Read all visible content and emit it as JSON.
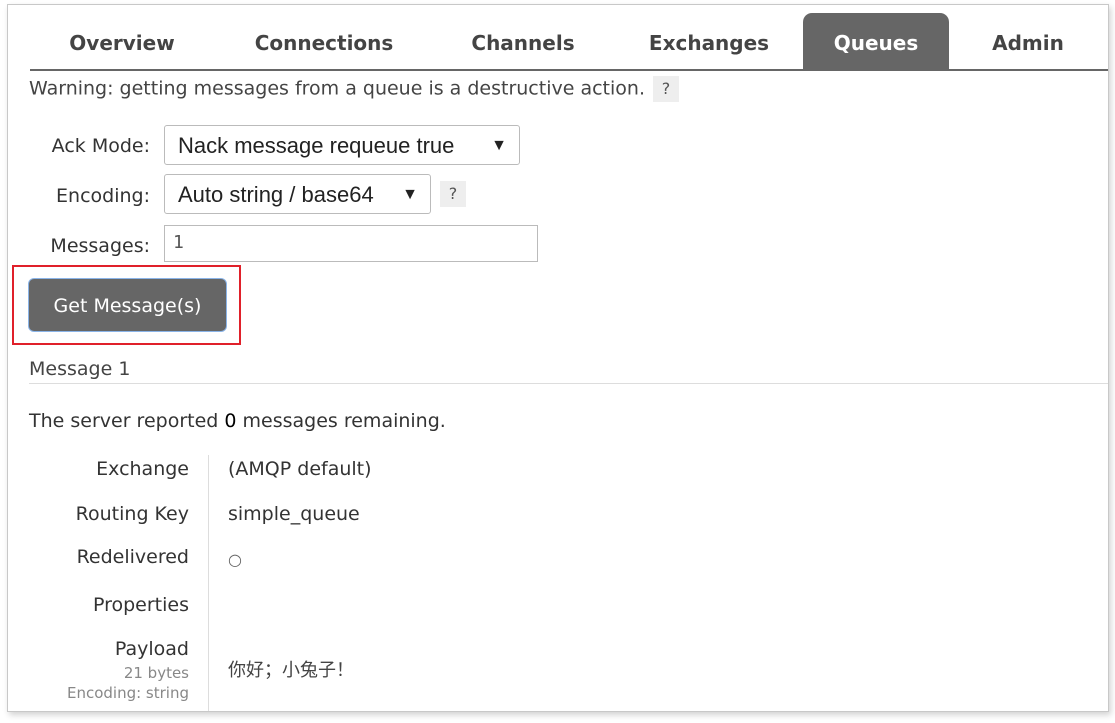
{
  "tabs": [
    {
      "label": "Overview",
      "active": false
    },
    {
      "label": "Connections",
      "active": false
    },
    {
      "label": "Channels",
      "active": false
    },
    {
      "label": "Exchanges",
      "active": false
    },
    {
      "label": "Queues",
      "active": true
    },
    {
      "label": "Admin",
      "active": false
    }
  ],
  "warning": {
    "text": "Warning: getting messages from a queue is a destructive action.",
    "help": "?"
  },
  "form": {
    "ack_mode_label": "Ack Mode:",
    "ack_mode_value": "Nack message requeue true",
    "encoding_label": "Encoding:",
    "encoding_value": "Auto string / base64",
    "encoding_help": "?",
    "messages_label": "Messages:",
    "messages_value": "1",
    "dropdown_arrow": "▼",
    "submit_label": "Get Message(s)"
  },
  "message": {
    "title": "Message 1",
    "server_prefix": "The server reported ",
    "remaining_count": "0",
    "server_suffix": " messages remaining.",
    "properties": {
      "exchange_label": "Exchange",
      "exchange_value": "(AMQP default)",
      "routing_key_label": "Routing Key",
      "routing_key_value": "simple_queue",
      "redelivered_label": "Redelivered",
      "redelivered_value": "○",
      "properties_label": "Properties",
      "payload_label": "Payload",
      "payload_size": "21 bytes",
      "payload_encoding": "Encoding: string",
      "payload_value": "你好；小兔子！"
    }
  },
  "colors": {
    "tab_active": "#666666",
    "highlight_border": "#e0202a"
  }
}
